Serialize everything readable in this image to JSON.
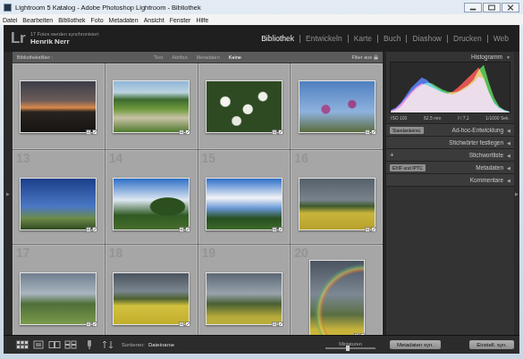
{
  "window": {
    "title": "Lightroom 5 Katalog - Adobe Photoshop Lightroom - Bibliothek"
  },
  "menu": [
    "Datei",
    "Bearbeiten",
    "Bibliothek",
    "Foto",
    "Metadaten",
    "Ansicht",
    "Fenster",
    "Hilfe"
  ],
  "identity": {
    "logo": "Lr",
    "status": "17 Fotos werden synchronisiert",
    "user": "Henrik Nerr"
  },
  "modules": [
    {
      "label": "Bibliothek",
      "selected": true
    },
    {
      "label": "Entwickeln",
      "selected": false
    },
    {
      "label": "Karte",
      "selected": false
    },
    {
      "label": "Buch",
      "selected": false
    },
    {
      "label": "Diashow",
      "selected": false
    },
    {
      "label": "Drucken",
      "selected": false
    },
    {
      "label": "Web",
      "selected": false
    }
  ],
  "filter_bar": {
    "label": "Bibliotheksfilter :",
    "options": [
      {
        "label": "Text",
        "selected": false
      },
      {
        "label": "Attribut",
        "selected": false
      },
      {
        "label": "Metadaten",
        "selected": false
      },
      {
        "label": "Keine",
        "selected": true
      }
    ],
    "status": "Filter aus"
  },
  "edge_arrows": {
    "left": "▶",
    "right": "▶"
  },
  "grid": {
    "cells": [
      {
        "portrait": false,
        "selected": false
      },
      {
        "portrait": false,
        "selected": false
      },
      {
        "portrait": false,
        "selected": false
      },
      {
        "portrait": false,
        "selected": false
      },
      {
        "number": "13",
        "portrait": false,
        "selected": false
      },
      {
        "number": "14",
        "portrait": false,
        "selected": false
      },
      {
        "number": "15",
        "portrait": false,
        "selected": false
      },
      {
        "number": "16",
        "portrait": false,
        "selected": false
      },
      {
        "number": "17",
        "portrait": false,
        "selected": false
      },
      {
        "number": "18",
        "portrait": false,
        "selected": false
      },
      {
        "number": "19",
        "portrait": false,
        "selected": false
      },
      {
        "number": "20",
        "portrait": true,
        "selected": false
      }
    ]
  },
  "histogram": {
    "title": "Histogramm",
    "arrow": "▼",
    "series": [
      {
        "name": "Blau",
        "color": "#3a6cff",
        "values": [
          5,
          10,
          20,
          35,
          50,
          60,
          70,
          65,
          55,
          48,
          42,
          38,
          36,
          40,
          45,
          52,
          60,
          72,
          68,
          40,
          20,
          10,
          5,
          2
        ]
      },
      {
        "name": "Grün",
        "color": "#3ccf3c",
        "values": [
          2,
          5,
          12,
          25,
          38,
          48,
          55,
          60,
          58,
          52,
          46,
          42,
          40,
          42,
          48,
          55,
          65,
          85,
          95,
          60,
          30,
          12,
          5,
          2
        ]
      },
      {
        "name": "Rot",
        "color": "#ff3a3a",
        "values": [
          3,
          8,
          18,
          30,
          42,
          52,
          58,
          55,
          50,
          45,
          40,
          38,
          42,
          50,
          60,
          70,
          80,
          90,
          70,
          40,
          18,
          8,
          3,
          1
        ]
      }
    ],
    "info": [
      "ISO 100",
      "62,5 mm",
      "f / 7,1",
      "1/1000 Sek."
    ]
  },
  "panels": [
    {
      "label": "Ad-hoc-Entwicklung",
      "arrow": "◀",
      "preset": "Standardeinst."
    },
    {
      "label": "Stichwörter festlegen",
      "arrow": "◀"
    },
    {
      "label": "Stichwortliste",
      "arrow": "◀",
      "prefix": "+"
    },
    {
      "label": "Metadaten",
      "arrow": "◀",
      "preset": "EXIF und IPTC"
    },
    {
      "label": "Kommentare",
      "arrow": "◀"
    }
  ],
  "toolbar": {
    "sort_label": "Sortieren:",
    "sort_value": "Dateiname",
    "thumb_label": "Miniaturen",
    "thumb_level": 0.45
  },
  "sync_buttons": [
    "Metadaten syn.",
    "Einstell. syn."
  ]
}
